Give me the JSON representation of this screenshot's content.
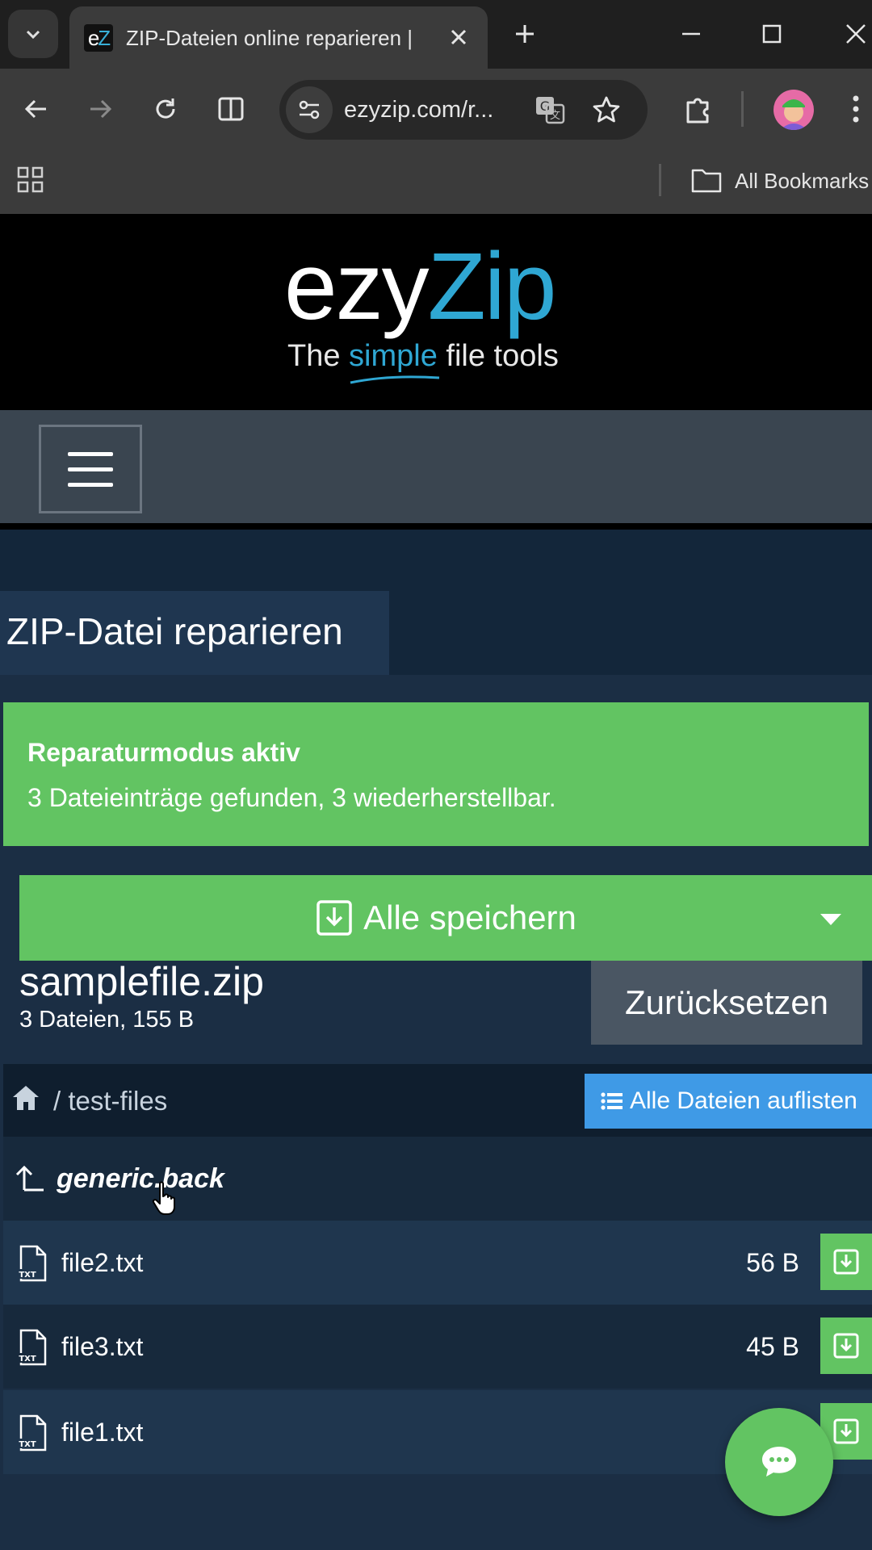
{
  "browser": {
    "tab_title": "ZIP-Dateien online reparieren | ",
    "favicon_text_e": "e",
    "favicon_text_z": "Z",
    "url": "ezyzip.com/r...",
    "bookmarks_label": "All Bookmarks",
    "icons": [
      "tab-search-icon",
      "close-icon",
      "plus-icon",
      "minimize-icon",
      "maximize-icon",
      "window-close-icon",
      "back-icon",
      "forward-icon",
      "reload-icon",
      "split-view-icon",
      "site-info-icon",
      "translate-icon",
      "star-icon",
      "extensions-icon",
      "avatar",
      "more-icon",
      "apps-icon",
      "folder-icon"
    ]
  },
  "site": {
    "logo_ezy": "ezy",
    "logo_zip": "Zip",
    "tagline_pre": "The ",
    "tagline_simple": "simple",
    "tagline_post": " file tools",
    "page_title": "ZIP-Datei reparieren",
    "alert": {
      "title": "Reparaturmodus aktiv",
      "text": "3 Dateieinträge gefunden, 3 wiederherstellbar."
    },
    "save_all_label": "Alle speichern",
    "archive": {
      "name": "samplefile.zip",
      "meta": "3 Dateien, 155 B"
    },
    "reset_label": "Zurücksetzen",
    "breadcrumb": "/ test-files",
    "list_all_label": "Alle Dateien auflisten",
    "back_label": "generic.back",
    "files": [
      {
        "name": "file2.txt",
        "size": "56 B"
      },
      {
        "name": "file3.txt",
        "size": "45 B"
      },
      {
        "name": "file1.txt",
        "size": ""
      }
    ],
    "colors": {
      "accent_blue": "#2fa7d3",
      "success_green": "#62c462",
      "button_blue": "#3f9ae6",
      "page_bg": "#1b2e44"
    }
  }
}
